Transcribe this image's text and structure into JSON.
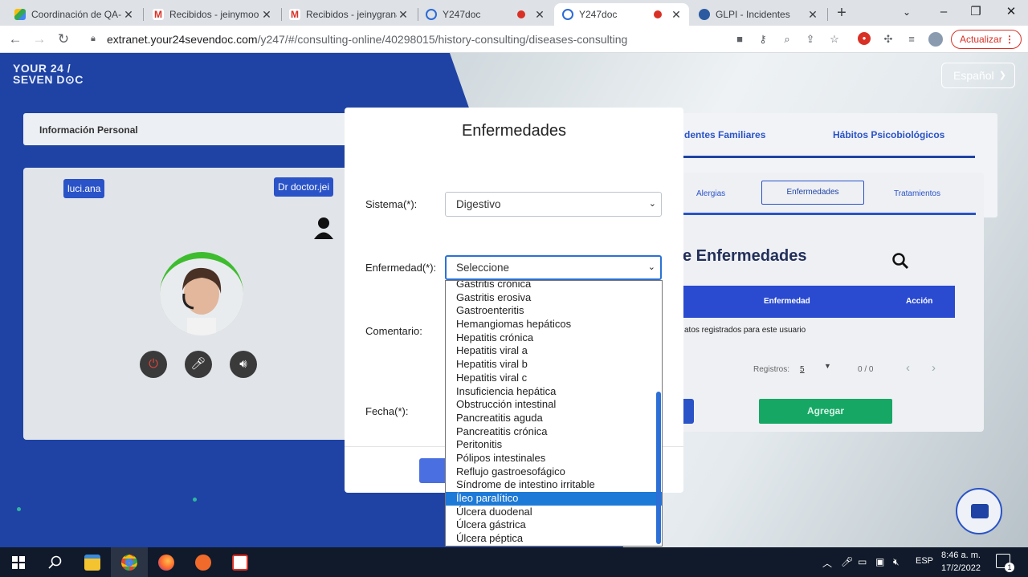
{
  "browser": {
    "tabs": [
      {
        "title": "Coordinación de QA-",
        "favicon": "google-drive-icon",
        "active": false
      },
      {
        "title": "Recibidos - jeinymoo",
        "favicon": "gmail-icon",
        "active": false
      },
      {
        "title": "Recibidos - jeinygrana",
        "favicon": "gmail-icon",
        "active": false
      },
      {
        "title": "Y247doc",
        "favicon": "y247-icon",
        "active": false,
        "recording": true
      },
      {
        "title": "Y247doc",
        "favicon": "y247-icon",
        "active": true,
        "recording": true
      },
      {
        "title": "GLPI - Incidentes",
        "favicon": "glpi-icon",
        "active": false
      }
    ],
    "url_host": "extranet.your24sevendoc.com",
    "url_path": "/y247/#/consulting-online/40298015/history-consulting/diseases-consulting",
    "update_button": "Actualizar"
  },
  "page": {
    "logo_line1": "YOUR 24 /",
    "logo_line2": "SEVEN D⊙C",
    "language": "Español",
    "info_personal": "Información Personal",
    "patient_tag": "luci.ana",
    "doctor_tag": "Dr doctor.jei",
    "right_tabs": [
      "dentes Familiares",
      "Hábitos Psicobiológicos"
    ],
    "sub_tabs": [
      "Alergias",
      "Enfermedades",
      "Tratamientos"
    ],
    "section_title": "e Enfermedades",
    "table_headers": [
      "Enfermedad",
      "Acción"
    ],
    "empty_message": "atos registrados para este usuario",
    "pager_label": "Registros:",
    "pager_size": "5",
    "pager_range": "0 / 0",
    "add_button": "Agregar"
  },
  "modal": {
    "title": "Enfermedades",
    "sistema_label": "Sistema(*):",
    "sistema_value": "Digestivo",
    "enfermedad_label": "Enfermedad(*):",
    "enfermedad_value": "Seleccione",
    "comentario_label": "Comentario:",
    "fecha_label": "Fecha(*):"
  },
  "dropdown": {
    "options": [
      "Gastritis crónica",
      "Gastritis erosiva",
      "Gastroenteritis",
      "Hemangiomas hepáticos",
      "Hepatitis crónica",
      "Hepatitis viral a",
      "Hepatitis viral b",
      "Hepatitis viral c",
      "Insuficiencia hepática",
      "Obstrucción intestinal",
      "Pancreatitis aguda",
      "Pancreatitis crónica",
      "Peritonitis",
      "Pólipos intestinales",
      "Reflujo gastroesofágico",
      "Síndrome de intestino irritable",
      "Íleo paralítico",
      "Úlcera duodenal",
      "Úlcera gástrica",
      "Úlcera péptica"
    ],
    "highlighted": "Íleo paralítico"
  },
  "taskbar": {
    "language": "ESP",
    "time": "8:46 a. m.",
    "date": "17/2/2022",
    "notifications": "1"
  },
  "colors": {
    "brand_blue": "#1f43a4",
    "accent_green": "#16a765",
    "selection_blue": "#1e7ad7"
  }
}
